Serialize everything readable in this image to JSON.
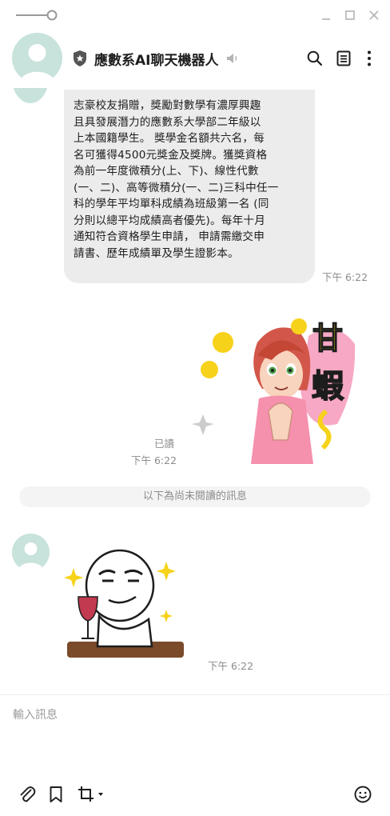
{
  "window": {
    "pin_icon": "pin-slider-icon",
    "minimize_icon": "minimize-icon",
    "maximize_icon": "maximize-icon",
    "close_icon": "close-icon"
  },
  "header": {
    "chat_name": "應數系AI聊天機器人",
    "official_badge_icon": "shield-star-icon",
    "mute_icon": "speaker-muted-icon",
    "actions": [
      "search-icon",
      "notes-icon",
      "more-icon"
    ]
  },
  "messages": {
    "bot_message_lines": [
      "志豪校友捐贈，獎勵對數學有濃厚興趣",
      "且具發展潛力的應數系大學部二年級以",
      "上本國籍學生。 獎學金名額共六名，每",
      "名可獲得4500元獎金及獎牌。獲獎資格",
      "為前一年度微積分(上、下)、線性代數",
      "(一、二)、高等微積分(一、二)三科中任一",
      "科的學年平均單科成績為班級第一名 (同",
      "分則以總平均成績高者優先)。每年十月",
      "通知符合資格學生申請， 申請需繳交申",
      "請書、歷年成績單及學生證影本。"
    ],
    "bot_message_time": "下午 6:22",
    "user_sticker_text": "甘蝦~",
    "read_label": "已讀",
    "user_sticker_time": "下午 6:22",
    "unread_divider": "以下為尚未閱讀的訊息",
    "bot_sticker_time": "下午 6:22"
  },
  "composer": {
    "placeholder": "輸入訊息",
    "tools": [
      "paperclip-icon",
      "bookmark-icon",
      "crop-icon",
      "emoji-icon"
    ]
  },
  "colors": {
    "bubble": "#ececec",
    "avatar": "#c8e2dc",
    "timestamp": "#8c8c8c",
    "sticker_yellow": "#f7d21a",
    "sticker_pink": "#f7a8c4"
  }
}
